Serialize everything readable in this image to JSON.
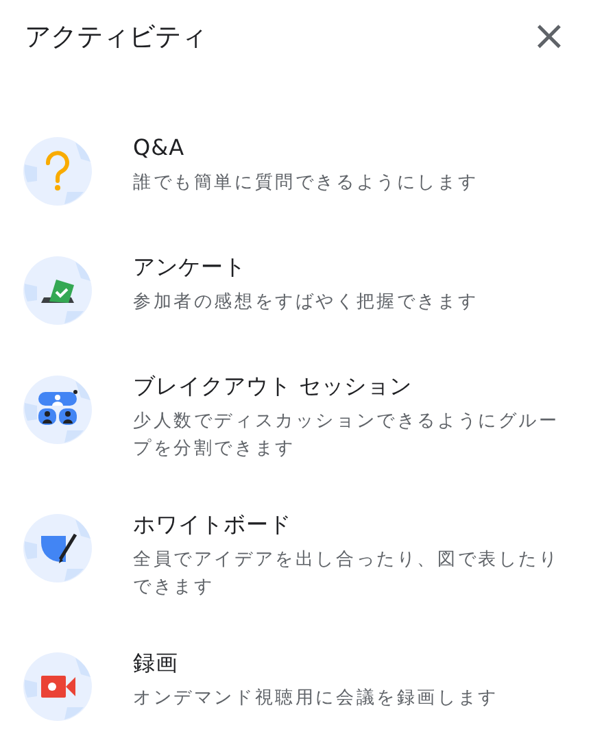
{
  "panel": {
    "title": "アクティビティ",
    "close": "×"
  },
  "activities": [
    {
      "kind": "qa",
      "title": "Q&A",
      "description": "誰でも簡単に質問できるようにします"
    },
    {
      "kind": "poll",
      "title": "アンケート",
      "description": "参加者の感想をすばやく把握できます"
    },
    {
      "kind": "breakout",
      "title": "ブレイクアウト セッション",
      "description": "少人数でディスカッションできるようにグループを分割できます"
    },
    {
      "kind": "whiteboard",
      "title": "ホワイトボード",
      "description": "全員でアイデアを出し合ったり、図で表したりできます"
    },
    {
      "kind": "recording",
      "title": "録画",
      "description": "オンデマンド視聴用に会議を録画します"
    }
  ]
}
